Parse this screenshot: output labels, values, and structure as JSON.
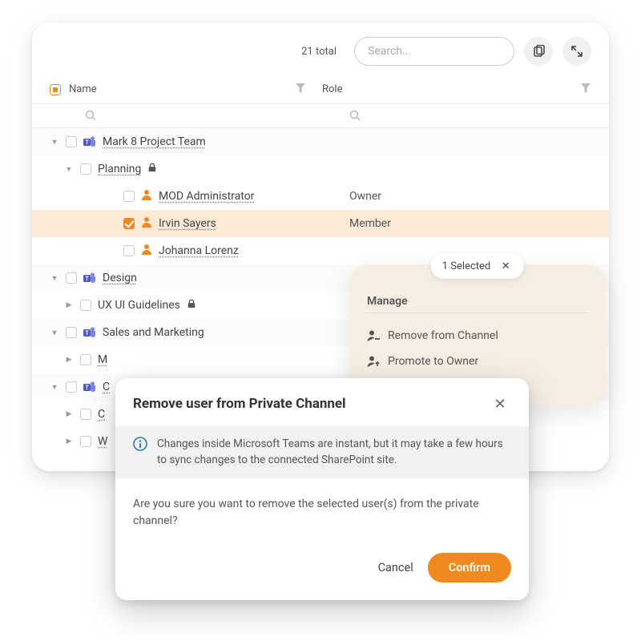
{
  "header": {
    "total_label": "21 total",
    "search_placeholder": "Search..."
  },
  "columns": {
    "name": "Name",
    "role": "Role"
  },
  "tree": {
    "team1": {
      "name": "Mark 8 Project Team"
    },
    "team1_ch1": {
      "name": "Planning"
    },
    "team1_ch1_u1": {
      "name": "MOD Administrator",
      "role": "Owner"
    },
    "team1_ch1_u2": {
      "name": "Irvin Sayers",
      "role": "Member"
    },
    "team1_ch1_u3": {
      "name": "Johanna Lorenz",
      "role": ""
    },
    "team2": {
      "name": "Design"
    },
    "team2_ch1": {
      "name": "UX UI Guidelines"
    },
    "team3": {
      "name": "Sales and Marketing"
    },
    "team3_ch1": {
      "name": "M"
    },
    "team4": {
      "name": "C"
    },
    "team4_ch1": {
      "name": "C"
    },
    "team4_ch2": {
      "name": "W"
    }
  },
  "panel": {
    "selected_label": "1 Selected",
    "title": "Manage",
    "action_remove": "Remove from Channel",
    "action_promote": "Promote to Owner"
  },
  "dialog": {
    "title": "Remove user from Private Channel",
    "info": "Changes inside Microsoft Teams are instant, but it may take a few hours to sync changes to the connected SharePoint site.",
    "body": "Are you sure you want to remove the selected user(s) from the private channel?",
    "cancel": "Cancel",
    "confirm": "Confirm"
  }
}
